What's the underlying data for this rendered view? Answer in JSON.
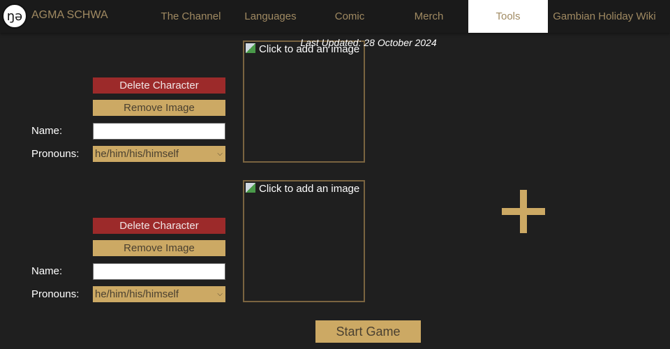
{
  "header": {
    "logo_text": "ŋə",
    "brand": "AGMA SCHWA",
    "nav": [
      {
        "label": "The Channel"
      },
      {
        "label": "Languages"
      },
      {
        "label": "Comic"
      },
      {
        "label": "Merch"
      },
      {
        "label": "Tools",
        "active": true
      },
      {
        "label": "Gambian Holiday Wiki"
      }
    ]
  },
  "last_updated": "Last Updated: 28 October 2024",
  "characters": [
    {
      "delete_label": "Delete Character",
      "remove_label": "Remove Image",
      "name_label": "Name:",
      "name_value": "",
      "pronouns_label": "Pronouns:",
      "pronouns_value": "he/him/his/himself",
      "image_placeholder": "Click to add an image"
    },
    {
      "delete_label": "Delete Character",
      "remove_label": "Remove Image",
      "name_label": "Name:",
      "name_value": "",
      "pronouns_label": "Pronouns:",
      "pronouns_value": "he/him/his/himself",
      "image_placeholder": "Click to add an image"
    }
  ],
  "add_icon": "plus-icon",
  "start_label": "Start Game",
  "colors": {
    "gold": "#cca964",
    "red": "#9c2a2a",
    "background": "#1f1f1f"
  }
}
